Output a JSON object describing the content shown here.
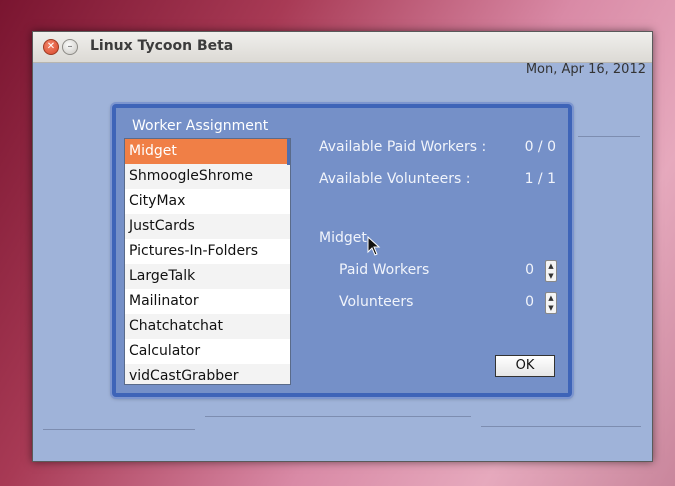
{
  "window": {
    "title": "Linux Tycoon Beta",
    "date": "Mon, Apr 16, 2012",
    "close_icon": "close-icon",
    "minimize_icon": "minimize-icon"
  },
  "dialog": {
    "title": "Worker Assignment",
    "projects": [
      "Midget",
      "ShmoogleShrome",
      "CityMax",
      "JustCards",
      "Pictures-In-Folders",
      "LargeTalk",
      "Mailinator",
      "Chatchatchat",
      "Calculator",
      "vidCastGrabber"
    ],
    "selected_project": "Midget",
    "available_paid_label": "Available Paid Workers :",
    "available_paid_value": "0 / 0",
    "available_volunteers_label": "Available Volunteers :",
    "available_volunteers_value": "1 / 1",
    "project_heading": "Midget",
    "paid_workers_label": "Paid Workers",
    "paid_workers_value": "0",
    "volunteers_label": "Volunteers",
    "volunteers_value": "0",
    "ok_label": "OK"
  },
  "colors": {
    "selection": "#f07f46",
    "dialog_bg": "#7590c8",
    "dialog_border": "#3e64b8",
    "window_bg": "#9fb3d9"
  }
}
